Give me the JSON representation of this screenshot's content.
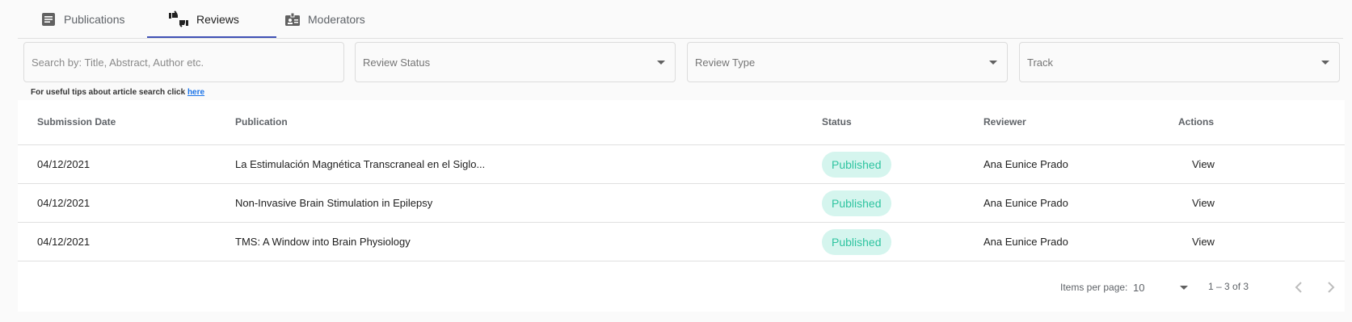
{
  "tabs": [
    {
      "label": "Publications",
      "icon": "document-icon"
    },
    {
      "label": "Reviews",
      "icon": "thumbs-up-down-icon"
    },
    {
      "label": "Moderators",
      "icon": "badge-icon"
    }
  ],
  "filters": {
    "search_placeholder": "Search by: Title, Abstract, Author etc.",
    "review_status": "Review Status",
    "review_type": "Review Type",
    "track": "Track"
  },
  "tips": {
    "text": "For useful tips about article search click",
    "link": "here"
  },
  "table": {
    "headers": [
      "Submission Date",
      "Publication",
      "Status",
      "Reviewer",
      "Actions"
    ],
    "rows": [
      {
        "date": "04/12/2021",
        "publication": "La Estimulación Magnética Transcraneal en el Siglo...",
        "status": "Published",
        "reviewer": "Ana Eunice Prado",
        "action": "View"
      },
      {
        "date": "04/12/2021",
        "publication": "Non-Invasive Brain Stimulation in Epilepsy",
        "status": "Published",
        "reviewer": "Ana Eunice Prado",
        "action": "View"
      },
      {
        "date": "04/12/2021",
        "publication": "TMS: A Window into Brain Physiology",
        "status": "Published",
        "reviewer": "Ana Eunice Prado",
        "action": "View"
      }
    ]
  },
  "paginator": {
    "items_per_page_label": "Items per page:",
    "page_size": "10",
    "range": "1 – 3 of 3"
  },
  "colors": {
    "accent": "#3f51b5",
    "status_bg": "#d5f5ee",
    "status_text": "#2ec4a0"
  }
}
